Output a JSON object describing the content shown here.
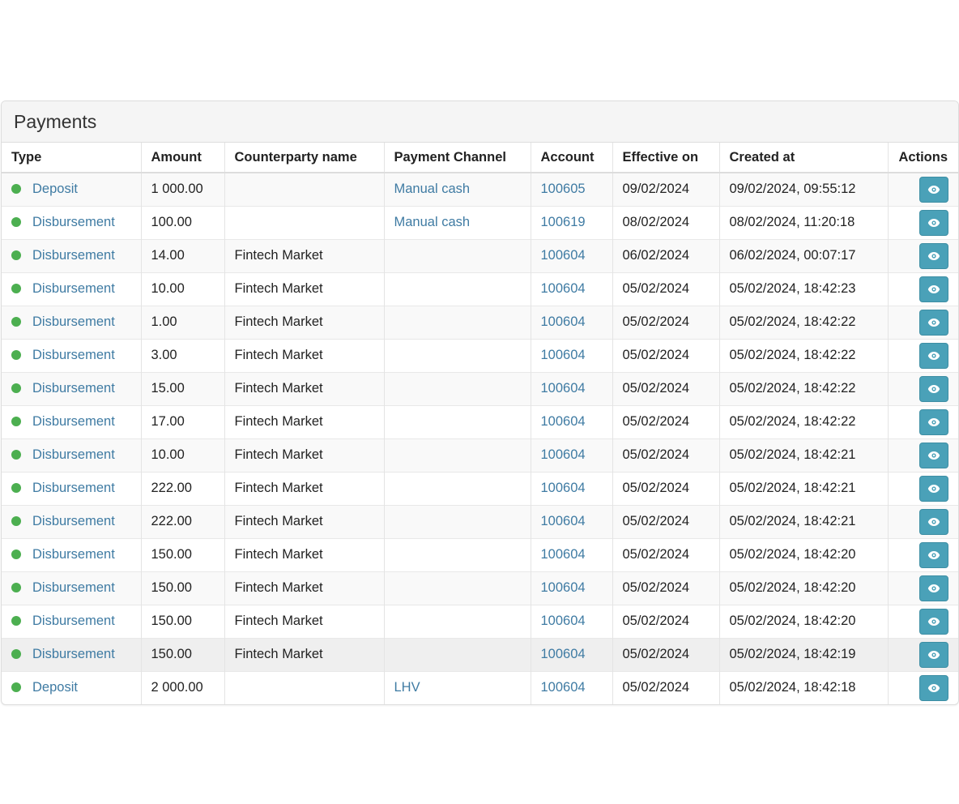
{
  "panel": {
    "title": "Payments"
  },
  "table": {
    "headers": {
      "type": "Type",
      "amount": "Amount",
      "counterparty": "Counterparty name",
      "channel": "Payment Channel",
      "account": "Account",
      "effective": "Effective on",
      "created": "Created at",
      "actions": "Actions"
    },
    "rows": [
      {
        "type": "Deposit",
        "amount": "1 000.00",
        "counterparty": "",
        "channel": "Manual cash",
        "account": "100605",
        "effective": "09/02/2024",
        "created": "09/02/2024, 09:55:12"
      },
      {
        "type": "Disbursement",
        "amount": "100.00",
        "counterparty": "",
        "channel": "Manual cash",
        "account": "100619",
        "effective": "08/02/2024",
        "created": "08/02/2024, 11:20:18"
      },
      {
        "type": "Disbursement",
        "amount": "14.00",
        "counterparty": "Fintech Market",
        "channel": "",
        "account": "100604",
        "effective": "06/02/2024",
        "created": "06/02/2024, 00:07:17"
      },
      {
        "type": "Disbursement",
        "amount": "10.00",
        "counterparty": "Fintech Market",
        "channel": "",
        "account": "100604",
        "effective": "05/02/2024",
        "created": "05/02/2024, 18:42:23"
      },
      {
        "type": "Disbursement",
        "amount": "1.00",
        "counterparty": "Fintech Market",
        "channel": "",
        "account": "100604",
        "effective": "05/02/2024",
        "created": "05/02/2024, 18:42:22"
      },
      {
        "type": "Disbursement",
        "amount": "3.00",
        "counterparty": "Fintech Market",
        "channel": "",
        "account": "100604",
        "effective": "05/02/2024",
        "created": "05/02/2024, 18:42:22"
      },
      {
        "type": "Disbursement",
        "amount": "15.00",
        "counterparty": "Fintech Market",
        "channel": "",
        "account": "100604",
        "effective": "05/02/2024",
        "created": "05/02/2024, 18:42:22"
      },
      {
        "type": "Disbursement",
        "amount": "17.00",
        "counterparty": "Fintech Market",
        "channel": "",
        "account": "100604",
        "effective": "05/02/2024",
        "created": "05/02/2024, 18:42:22"
      },
      {
        "type": "Disbursement",
        "amount": "10.00",
        "counterparty": "Fintech Market",
        "channel": "",
        "account": "100604",
        "effective": "05/02/2024",
        "created": "05/02/2024, 18:42:21"
      },
      {
        "type": "Disbursement",
        "amount": "222.00",
        "counterparty": "Fintech Market",
        "channel": "",
        "account": "100604",
        "effective": "05/02/2024",
        "created": "05/02/2024, 18:42:21"
      },
      {
        "type": "Disbursement",
        "amount": "222.00",
        "counterparty": "Fintech Market",
        "channel": "",
        "account": "100604",
        "effective": "05/02/2024",
        "created": "05/02/2024, 18:42:21"
      },
      {
        "type": "Disbursement",
        "amount": "150.00",
        "counterparty": "Fintech Market",
        "channel": "",
        "account": "100604",
        "effective": "05/02/2024",
        "created": "05/02/2024, 18:42:20"
      },
      {
        "type": "Disbursement",
        "amount": "150.00",
        "counterparty": "Fintech Market",
        "channel": "",
        "account": "100604",
        "effective": "05/02/2024",
        "created": "05/02/2024, 18:42:20"
      },
      {
        "type": "Disbursement",
        "amount": "150.00",
        "counterparty": "Fintech Market",
        "channel": "",
        "account": "100604",
        "effective": "05/02/2024",
        "created": "05/02/2024, 18:42:20"
      },
      {
        "type": "Disbursement",
        "amount": "150.00",
        "counterparty": "Fintech Market",
        "channel": "",
        "account": "100604",
        "effective": "05/02/2024",
        "created": "05/02/2024, 18:42:19",
        "hovered": true
      },
      {
        "type": "Deposit",
        "amount": "2 000.00",
        "counterparty": "",
        "channel": "LHV",
        "account": "100604",
        "effective": "05/02/2024",
        "created": "05/02/2024, 18:42:18"
      }
    ]
  },
  "icons": {
    "status": "status-dot-icon",
    "view": "eye-icon"
  },
  "colors": {
    "status_ok": "#4caf50",
    "link": "#3f7ba3",
    "button": "#4aa1b8",
    "hover_row": "#efefef"
  }
}
